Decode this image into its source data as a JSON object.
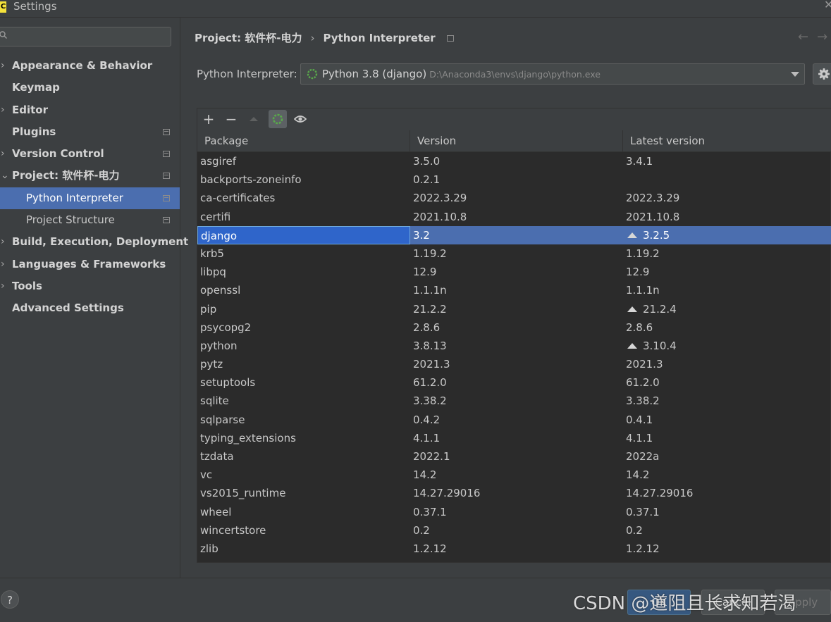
{
  "window": {
    "title": "Settings",
    "app_icon_label": "C"
  },
  "sidebar": {
    "search_placeholder": "Q▾",
    "items": [
      {
        "label": "Appearance & Behavior",
        "arrow": "›"
      },
      {
        "label": "Keymap",
        "arrow": ""
      },
      {
        "label": "Editor",
        "arrow": "›"
      },
      {
        "label": "Plugins",
        "arrow": ""
      },
      {
        "label": "Version Control",
        "arrow": "›"
      },
      {
        "label": "Project: 软件杯-电力",
        "arrow": "⌄"
      },
      {
        "label": "Python Interpreter",
        "arrow": ""
      },
      {
        "label": "Project Structure",
        "arrow": ""
      },
      {
        "label": "Build, Execution, Deployment",
        "arrow": "›"
      },
      {
        "label": "Languages & Frameworks",
        "arrow": "›"
      },
      {
        "label": "Tools",
        "arrow": "›"
      },
      {
        "label": "Advanced Settings",
        "arrow": ""
      }
    ]
  },
  "breadcrumb": {
    "project": "Project: 软件杯-电力",
    "separator": "›",
    "page": "Python Interpreter",
    "back": "←",
    "forward": "→"
  },
  "interpreter": {
    "label": "Python Interpreter:",
    "name": "Python 3.8 (django)",
    "path": "D:\\Anaconda3\\envs\\django\\python.exe"
  },
  "toolbar": {
    "add": "+",
    "remove": "−"
  },
  "table": {
    "headers": {
      "package": "Package",
      "version": "Version",
      "latest": "Latest version"
    },
    "rows": [
      {
        "package": "asgiref",
        "version": "3.5.0",
        "latest": "3.4.1",
        "upgrade": false
      },
      {
        "package": "backports-zoneinfo",
        "version": "0.2.1",
        "latest": "",
        "upgrade": false
      },
      {
        "package": "ca-certificates",
        "version": "2022.3.29",
        "latest": "2022.3.29",
        "upgrade": false
      },
      {
        "package": "certifi",
        "version": "2021.10.8",
        "latest": "2021.10.8",
        "upgrade": false
      },
      {
        "package": "django",
        "version": "3.2",
        "latest": "3.2.5",
        "upgrade": true
      },
      {
        "package": "krb5",
        "version": "1.19.2",
        "latest": "1.19.2",
        "upgrade": false
      },
      {
        "package": "libpq",
        "version": "12.9",
        "latest": "12.9",
        "upgrade": false
      },
      {
        "package": "openssl",
        "version": "1.1.1n",
        "latest": "1.1.1n",
        "upgrade": false
      },
      {
        "package": "pip",
        "version": "21.2.2",
        "latest": "21.2.4",
        "upgrade": true
      },
      {
        "package": "psycopg2",
        "version": "2.8.6",
        "latest": "2.8.6",
        "upgrade": false
      },
      {
        "package": "python",
        "version": "3.8.13",
        "latest": "3.10.4",
        "upgrade": true
      },
      {
        "package": "pytz",
        "version": "2021.3",
        "latest": "2021.3",
        "upgrade": false
      },
      {
        "package": "setuptools",
        "version": "61.2.0",
        "latest": "61.2.0",
        "upgrade": false
      },
      {
        "package": "sqlite",
        "version": "3.38.2",
        "latest": "3.38.2",
        "upgrade": false
      },
      {
        "package": "sqlparse",
        "version": "0.4.2",
        "latest": "0.4.1",
        "upgrade": false
      },
      {
        "package": "typing_extensions",
        "version": "4.1.1",
        "latest": "4.1.1",
        "upgrade": false
      },
      {
        "package": "tzdata",
        "version": "2022.1",
        "latest": "2022a",
        "upgrade": false
      },
      {
        "package": "vc",
        "version": "14.2",
        "latest": "14.2",
        "upgrade": false
      },
      {
        "package": "vs2015_runtime",
        "version": "14.27.29016",
        "latest": "14.27.29016",
        "upgrade": false
      },
      {
        "package": "wheel",
        "version": "0.37.1",
        "latest": "0.37.1",
        "upgrade": false
      },
      {
        "package": "wincertstore",
        "version": "0.2",
        "latest": "0.2",
        "upgrade": false
      },
      {
        "package": "zlib",
        "version": "1.2.12",
        "latest": "1.2.12",
        "upgrade": false
      }
    ]
  },
  "footer": {
    "help": "?",
    "ok": "OK",
    "cancel": "Cancel",
    "apply": "Apply",
    "watermark": "CSDN @道阻且长求知若渴"
  },
  "colors": {
    "selection": "#4b6eaf",
    "background": "#3c3f41",
    "table_bg": "#2b2b2b",
    "spinner": "#59a84b"
  },
  "icons": {
    "search": "search-icon",
    "gear": "gear-icon",
    "refresh": "refresh-spinner-icon",
    "eye": "eye-icon",
    "upgrade": "upgrade-triangle-icon",
    "page": "project-settings-icon"
  }
}
